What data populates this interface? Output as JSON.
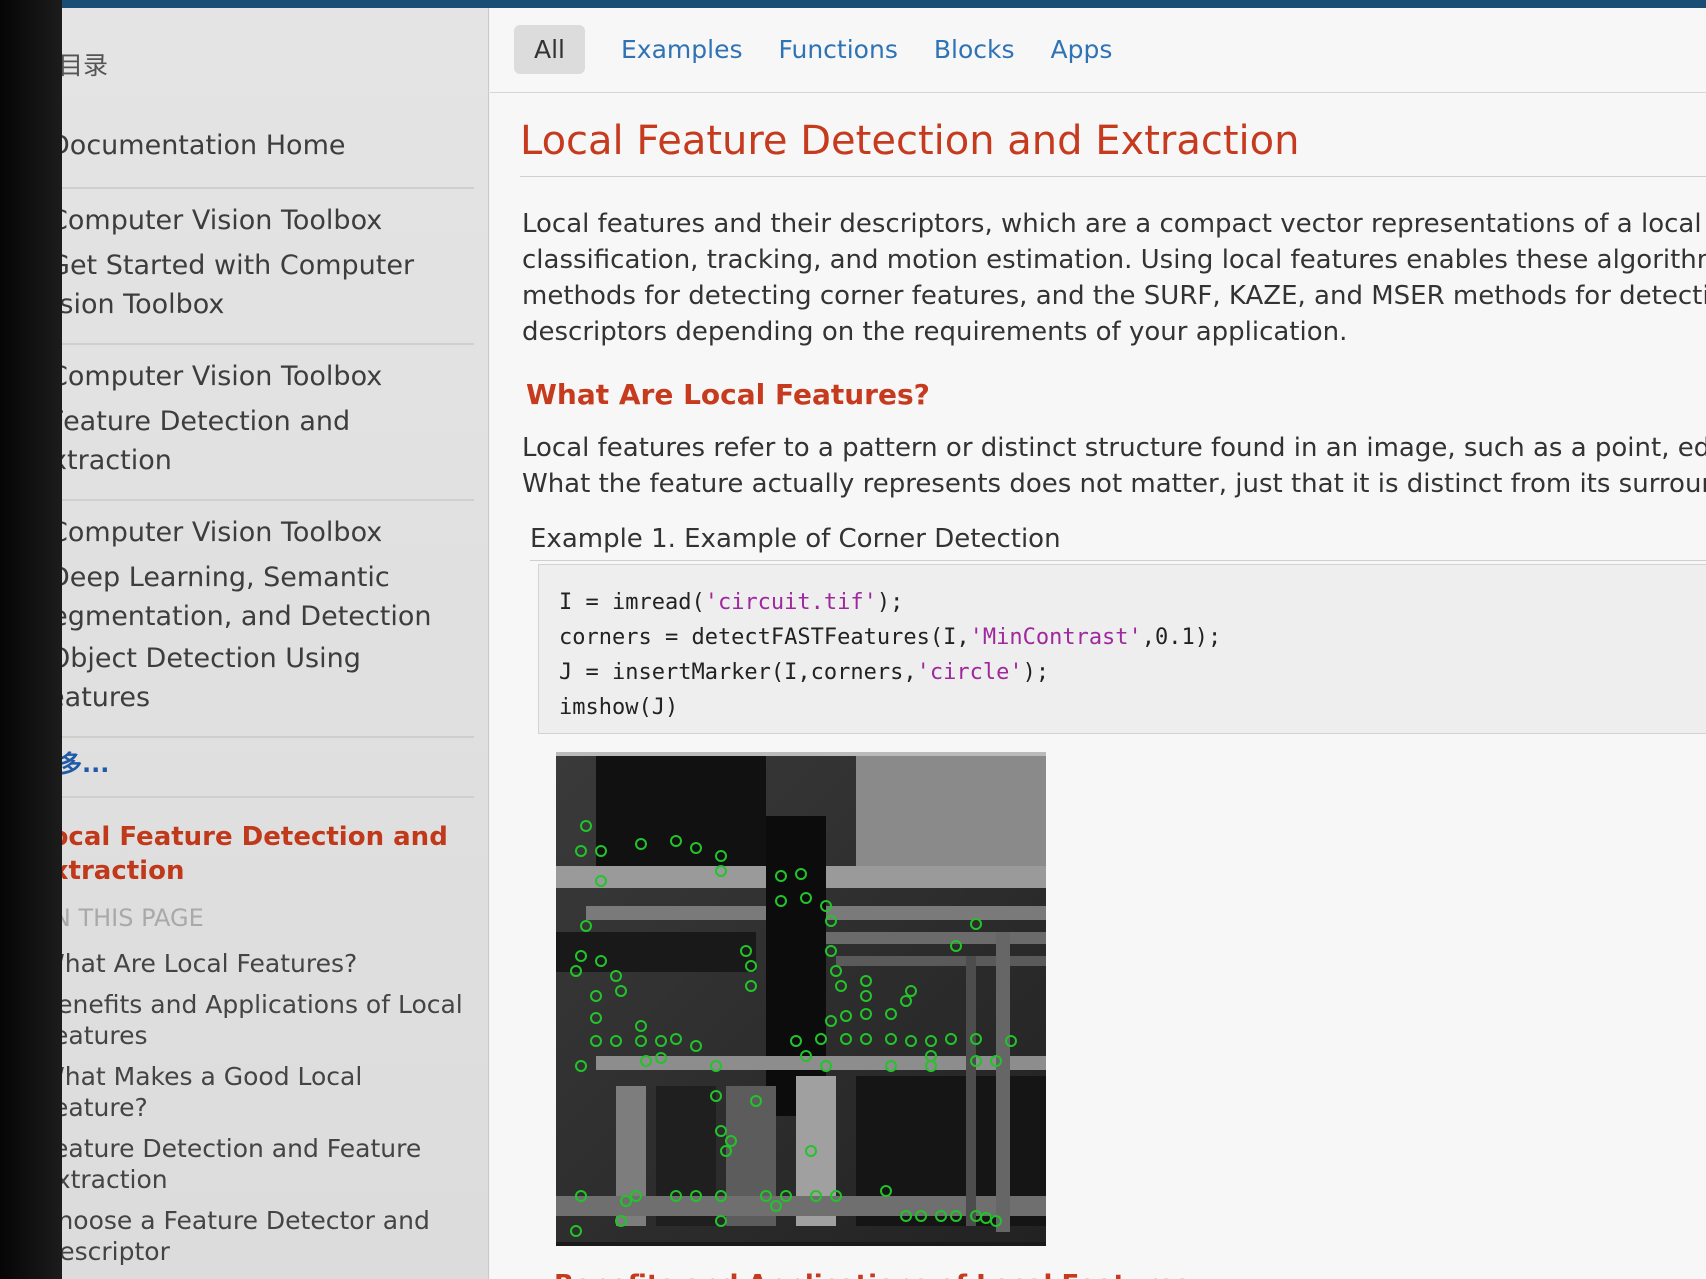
{
  "sidebar": {
    "toc_title": "目录",
    "groups": [
      {
        "items": [
          "Documentation Home"
        ]
      },
      {
        "items": [
          "Computer Vision Toolbox",
          "Get Started with Computer Vision Toolbox"
        ]
      },
      {
        "items": [
          "Computer Vision Toolbox",
          "Feature Detection and Extraction"
        ]
      },
      {
        "items": [
          "Computer Vision Toolbox",
          "Deep Learning, Semantic Segmentation, and Detection",
          "Object Detection Using Features"
        ]
      }
    ],
    "more_label": "更多...",
    "current_page": "Local Feature Detection and Extraction",
    "on_this_page_label": "ON THIS PAGE",
    "on_this_page": [
      "What Are Local Features?",
      "Benefits and Applications of Local Features",
      "What Makes a Good Local Feature?",
      "Feature Detection and Feature Extraction",
      "Choose a Feature Detector and Descriptor"
    ]
  },
  "tabs": [
    "All",
    "Examples",
    "Functions",
    "Blocks",
    "Apps"
  ],
  "active_tab": "All",
  "page": {
    "title": "Local Feature Detection and Extraction",
    "intro_lines": [
      "Local features and their descriptors, which are a compact vector representations of a local neig",
      "classification, tracking, and motion estimation. Using local features enables these algorithms to",
      "methods for detecting corner features, and the SURF, KAZE, and MSER methods for detecting",
      "descriptors depending on the requirements of your application."
    ],
    "section_heading": "What Are Local Features?",
    "section_lines": [
      "Local features refer to a pattern or distinct structure found in an image, such as a point, edge, c",
      "What the feature actually represents does not matter, just that it is distinct from its surroundin"
    ],
    "example_title": "Example 1. Example of Corner Detection",
    "code": {
      "line1_a": "I = imread(",
      "line1_s": "'circuit.tif'",
      "line1_b": ");",
      "line2_a": "corners = detectFASTFeatures(I,",
      "line2_s": "'MinContrast'",
      "line2_b": ",0.1);",
      "line3_a": "J = insertMarker(I,corners,",
      "line3_s": "'circle'",
      "line3_b": ");",
      "line4": "imshow(J)"
    },
    "next_heading": "Benefits and Applications of Local Features"
  },
  "colors": {
    "accent_red": "#c63a1e",
    "link_blue": "#2f73b5",
    "marker_green": "#22c42a"
  }
}
